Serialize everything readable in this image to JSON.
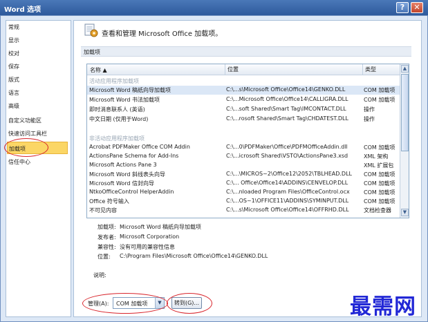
{
  "window": {
    "title": "Word 选项",
    "help_icon": "?",
    "close_icon": "✕"
  },
  "sidebar": {
    "items": [
      {
        "label": "常规"
      },
      {
        "label": "显示"
      },
      {
        "label": "校对"
      },
      {
        "label": "保存"
      },
      {
        "label": "版式"
      },
      {
        "label": "语言"
      },
      {
        "label": "高级"
      },
      {
        "label": "自定义功能区"
      },
      {
        "label": "快速访问工具栏"
      },
      {
        "label": "加载项",
        "selected": true
      },
      {
        "label": "信任中心"
      }
    ]
  },
  "main": {
    "heading": "查看和管理 Microsoft Office 加载项。",
    "section_title": "加载项",
    "table": {
      "columns": [
        "名称 ▲",
        "位置",
        "类型"
      ],
      "groups": [
        {
          "title": "活动应用程序加载项",
          "rows": [
            {
              "name": "Microsoft Word 稿纸向导加载项",
              "location": "C:\\...s\\Microsoft Office\\Office14\\GENKO.DLL",
              "type": "COM 加载项",
              "selected": true
            },
            {
              "name": "Microsoft Word 书法加载项",
              "location": "C:\\...Microsoft Office\\Office14\\CALLIGRA.DLL",
              "type": "COM 加载项"
            },
            {
              "name": "即时消息联系人 (英语)",
              "location": "C:\\...soft Shared\\Smart Tag\\IMCONTACT.DLL",
              "type": "操作"
            },
            {
              "name": "中文日期 (仅用于Word)",
              "location": "C:\\...rosoft Shared\\Smart Tag\\CHDATEST.DLL",
              "type": "操作"
            }
          ]
        },
        {
          "title": "非活动应用程序加载项",
          "rows": [
            {
              "name": "Acrobat PDFMaker Office COM Addin",
              "location": "C:\\...0\\PDFMaker\\Office\\PDFMOfficeAddin.dll",
              "type": "COM 加载项"
            },
            {
              "name": "ActionsPane Schema for Add-Ins",
              "location": "C:\\...icrosoft Shared\\VSTO\\ActionsPane3.xsd",
              "type": "XML 架构"
            },
            {
              "name": "Microsoft Actions Pane 3",
              "location": "",
              "type": "XML 扩展包"
            },
            {
              "name": "Microsoft Word 斜线表头向导",
              "location": "C:\\...\\MICROS~2\\Office12\\2052\\TBLHEAD.DLL",
              "type": "COM 加载项"
            },
            {
              "name": "Microsoft Word 信封向导",
              "location": "C:\\... Office\\Office14\\ADDINS\\CENVELOP.DLL",
              "type": "COM 加载项"
            },
            {
              "name": "NtkoOfficeControl HelperAddin",
              "location": "C:\\...nloaded Program Files\\OfficeControl.ocx",
              "type": "COM 加载项"
            },
            {
              "name": "Office 符号输入",
              "location": "C:\\...OS~1\\OFFICE11\\ADDINS\\SYMINPUT.DLL",
              "type": "COM 加载项"
            },
            {
              "name": "不可见内容",
              "location": "C:\\...s\\Microsoft Office\\Office14\\OFFRHD.DLL",
              "type": "文档检查器"
            }
          ]
        }
      ]
    },
    "details": {
      "addin_label": "加载项:",
      "addin_value": "Microsoft Word 稿纸向导加载项",
      "publisher_label": "发布者:",
      "publisher_value": "Microsoft Corporation",
      "compat_label": "兼容性:",
      "compat_value": "没有可用的兼容性信息",
      "location_label": "位置:",
      "location_value": "C:\\Program Files\\Microsoft Office\\Office14\\GENKO.DLL",
      "desc_label": "说明:"
    },
    "manage": {
      "label": "管理(A):",
      "selected": "COM 加载项",
      "go_button": "转到(G)..."
    }
  },
  "watermark": "最需网",
  "colors": {
    "annotation_red": "#d8232a",
    "selected_nav": "#fbd665",
    "watermark_blue": "#2228d6"
  },
  "icons": {
    "addin": "addin-gear-icon",
    "sort": "sort-up-icon",
    "dropdown": "chevron-down-icon"
  }
}
